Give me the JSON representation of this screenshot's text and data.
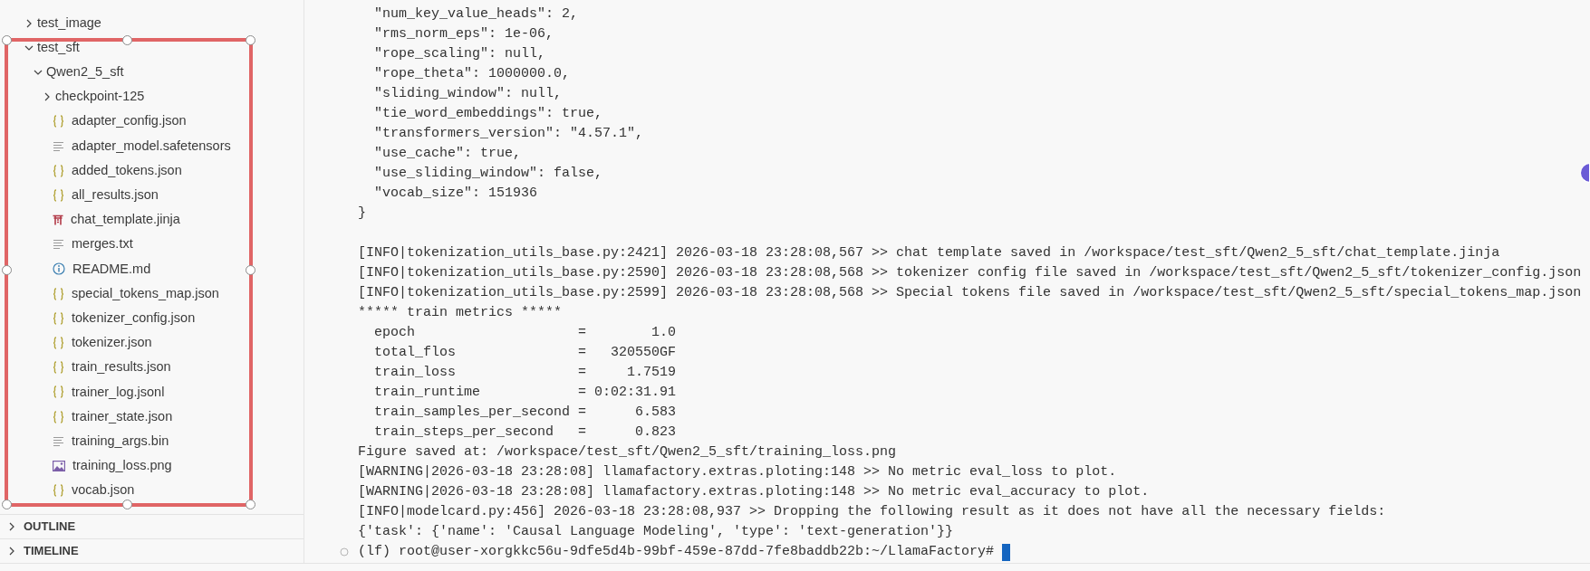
{
  "explorer": {
    "tree": [
      {
        "name": "test_image",
        "kind": "folder",
        "expanded": false
      },
      {
        "name": "test_sft",
        "kind": "folder",
        "expanded": true,
        "children": [
          {
            "name": "Qwen2_5_sft",
            "kind": "folder",
            "expanded": true,
            "children": [
              {
                "name": "checkpoint-125",
                "kind": "folder",
                "expanded": false
              },
              {
                "name": "adapter_config.json",
                "kind": "json"
              },
              {
                "name": "adapter_model.safetensors",
                "kind": "text"
              },
              {
                "name": "added_tokens.json",
                "kind": "json"
              },
              {
                "name": "all_results.json",
                "kind": "json"
              },
              {
                "name": "chat_template.jinja",
                "kind": "jinja"
              },
              {
                "name": "merges.txt",
                "kind": "text"
              },
              {
                "name": "README.md",
                "kind": "info"
              },
              {
                "name": "special_tokens_map.json",
                "kind": "json"
              },
              {
                "name": "tokenizer_config.json",
                "kind": "json"
              },
              {
                "name": "tokenizer.json",
                "kind": "json"
              },
              {
                "name": "train_results.json",
                "kind": "json"
              },
              {
                "name": "trainer_log.jsonl",
                "kind": "json"
              },
              {
                "name": "trainer_state.json",
                "kind": "json"
              },
              {
                "name": "training_args.bin",
                "kind": "text"
              },
              {
                "name": "training_loss.png",
                "kind": "image"
              },
              {
                "name": "vocab.json",
                "kind": "json"
              }
            ]
          }
        ]
      }
    ]
  },
  "panels": [
    {
      "title": "OUTLINE",
      "expanded": false
    },
    {
      "title": "TIMELINE",
      "expanded": false
    }
  ],
  "terminal": {
    "sections": [
      [
        "  \"num_key_value_heads\": 2,",
        "  \"rms_norm_eps\": 1e-06,",
        "  \"rope_scaling\": null,",
        "  \"rope_theta\": 1000000.0,",
        "  \"sliding_window\": null,",
        "  \"tie_word_embeddings\": true,",
        "  \"transformers_version\": \"4.57.1\",",
        "  \"use_cache\": true,",
        "  \"use_sliding_window\": false,",
        "  \"vocab_size\": 151936",
        "}"
      ],
      [
        "[INFO|tokenization_utils_base.py:2421] 2026-03-18 23:28:08,567 >> chat template saved in /workspace/test_sft/Qwen2_5_sft/chat_template.jinja",
        "[INFO|tokenization_utils_base.py:2590] 2026-03-18 23:28:08,568 >> tokenizer config file saved in /workspace/test_sft/Qwen2_5_sft/tokenizer_config.json",
        "[INFO|tokenization_utils_base.py:2599] 2026-03-18 23:28:08,568 >> Special tokens file saved in /workspace/test_sft/Qwen2_5_sft/special_tokens_map.json",
        "***** train metrics *****",
        "  epoch                    =        1.0",
        "  total_flos               =   320550GF",
        "  train_loss               =     1.7519",
        "  train_runtime            = 0:02:31.91",
        "  train_samples_per_second =      6.583",
        "  train_steps_per_second   =      0.823",
        "Figure saved at: /workspace/test_sft/Qwen2_5_sft/training_loss.png",
        "[WARNING|2026-03-18 23:28:08] llamafactory.extras.ploting:148 >> No metric eval_loss to plot.",
        "[WARNING|2026-03-18 23:28:08] llamafactory.extras.ploting:148 >> No metric eval_accuracy to plot.",
        "[INFO|modelcard.py:456] 2026-03-18 23:28:08,937 >> Dropping the following result as it does not have all the necessary fields:",
        "{'task': {'name': 'Causal Language Modeling', 'type': 'text-generation'}}"
      ]
    ],
    "prompt": "(lf) root@user-xorgkkc56u-9dfe5d4b-99bf-459e-87dd-7fe8baddb22b:~/LlamaFactory#"
  }
}
